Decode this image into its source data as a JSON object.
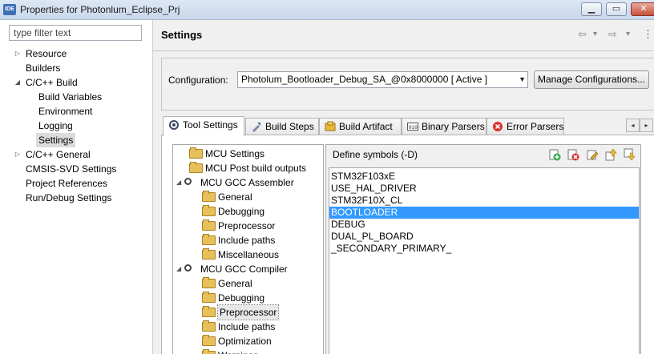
{
  "window": {
    "app_icon_text": "IDE",
    "title": "Properties for Photonlum_Eclipse_Prj",
    "min_label": "▁",
    "max_label": "▭",
    "close_label": "✕"
  },
  "left_panel": {
    "filter_placeholder": "type filter text",
    "tree": [
      {
        "label": "Resource",
        "expandable": true
      },
      {
        "label": "Builders",
        "expandable": false
      },
      {
        "label": "C/C++ Build",
        "expanded": true
      },
      {
        "label": "Build Variables",
        "child": true
      },
      {
        "label": "Environment",
        "child": true
      },
      {
        "label": "Logging",
        "child": true
      },
      {
        "label": "Settings",
        "child": true,
        "selected": true
      },
      {
        "label": "C/C++ General",
        "expandable": true
      },
      {
        "label": "CMSIS-SVD Settings",
        "expandable": false
      },
      {
        "label": "Project References",
        "expandable": false
      },
      {
        "label": "Run/Debug Settings",
        "expandable": false
      }
    ]
  },
  "header": {
    "title": "Settings",
    "back_icon": "⇦",
    "back_menu_icon": "▾",
    "forward_icon": "⇨",
    "forward_menu_icon": "▾",
    "menu_icon": "⋮"
  },
  "configuration": {
    "label": "Configuration:",
    "selected": "Photolum_Bootloader_Debug_SA_@0x8000000  [ Active ]",
    "manage_button": "Manage Configurations..."
  },
  "tabs": [
    {
      "label": "Tool Settings",
      "icon": "tool-settings-icon",
      "active": true
    },
    {
      "label": "Build Steps",
      "icon": "build-steps-icon"
    },
    {
      "label": "Build Artifact",
      "icon": "build-artifact-icon"
    },
    {
      "label": "Binary Parsers",
      "icon": "binary-parsers-icon"
    },
    {
      "label": "Error Parsers",
      "icon": "error-parsers-icon"
    }
  ],
  "tab_scroll": {
    "left": "◂",
    "right": "▸"
  },
  "settings_tree": [
    {
      "label": "MCU Settings",
      "level": 1,
      "icon": "folder"
    },
    {
      "label": "MCU Post build outputs",
      "level": 1,
      "icon": "folder"
    },
    {
      "label": "MCU GCC Assembler",
      "level": 0,
      "icon": "gear",
      "expanded": true
    },
    {
      "label": "General",
      "level": 2,
      "icon": "folder"
    },
    {
      "label": "Debugging",
      "level": 2,
      "icon": "folder"
    },
    {
      "label": "Preprocessor",
      "level": 2,
      "icon": "folder"
    },
    {
      "label": "Include paths",
      "level": 2,
      "icon": "folder"
    },
    {
      "label": "Miscellaneous",
      "level": 2,
      "icon": "folder"
    },
    {
      "label": "MCU GCC Compiler",
      "level": 0,
      "icon": "gear",
      "expanded": true
    },
    {
      "label": "General",
      "level": 2,
      "icon": "folder"
    },
    {
      "label": "Debugging",
      "level": 2,
      "icon": "folder"
    },
    {
      "label": "Preprocessor",
      "level": 2,
      "icon": "folder",
      "selected": true
    },
    {
      "label": "Include paths",
      "level": 2,
      "icon": "folder"
    },
    {
      "label": "Optimization",
      "level": 2,
      "icon": "folder"
    },
    {
      "label": "Warnings",
      "level": 2,
      "icon": "folder"
    }
  ],
  "symbols": {
    "title": "Define symbols (-D)",
    "toolbar": [
      "add-icon",
      "delete-icon",
      "edit-icon",
      "move-up-icon",
      "move-down-icon"
    ],
    "items": [
      {
        "label": "STM32F103xE"
      },
      {
        "label": "USE_HAL_DRIVER"
      },
      {
        "label": "STM32F10X_CL"
      },
      {
        "label": "BOOTLOADER",
        "selected": true
      },
      {
        "label": "DEBUG"
      },
      {
        "label": "DUAL_PL_BOARD"
      },
      {
        "label": "_SECONDARY_PRIMARY_"
      }
    ]
  }
}
